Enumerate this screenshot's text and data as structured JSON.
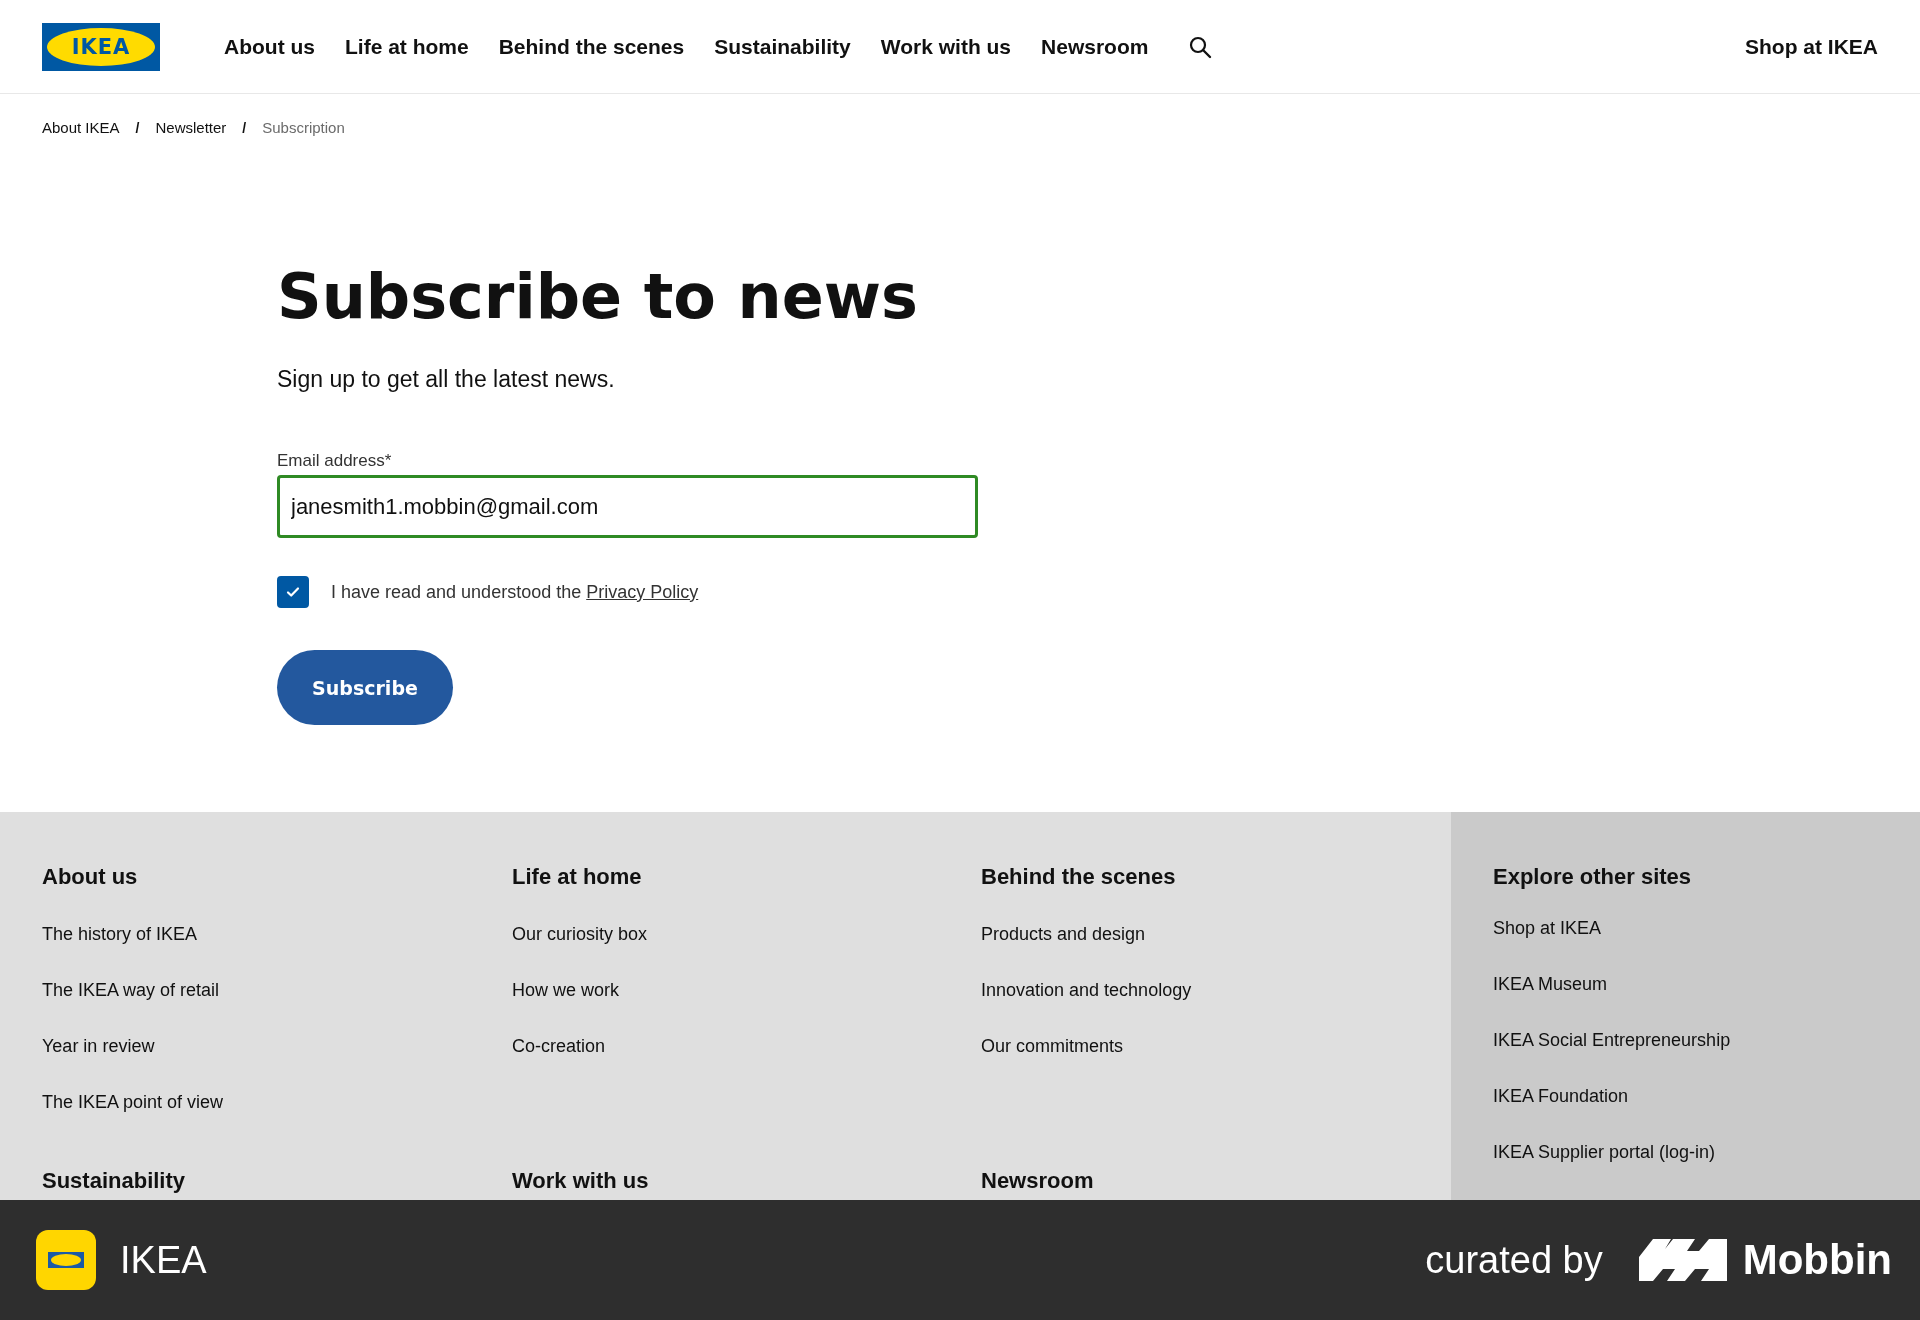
{
  "header": {
    "logo_text": "IKEA",
    "nav": [
      {
        "label": "About us"
      },
      {
        "label": "Life at home"
      },
      {
        "label": "Behind the scenes"
      },
      {
        "label": "Sustainability"
      },
      {
        "label": "Work with us"
      },
      {
        "label": "Newsroom"
      }
    ],
    "shop_link": "Shop at IKEA"
  },
  "breadcrumb": [
    {
      "label": "About IKEA",
      "current": false
    },
    {
      "label": "Newsletter",
      "current": false
    },
    {
      "label": "Subscription",
      "current": true
    }
  ],
  "breadcrumb_separator": "/",
  "form": {
    "title": "Subscribe to news",
    "subtitle": "Sign up to get all the latest news.",
    "email_label": "Email address*",
    "email_value": "janesmith1.mobbin@gmail.com",
    "consent_text": "I have read and understood the ",
    "consent_link": "Privacy Policy",
    "consent_checked": true,
    "submit": "Subscribe"
  },
  "footer": {
    "columns": [
      {
        "heading": "About us",
        "links": [
          "The history of IKEA",
          "The IKEA way of retail",
          "Year in review",
          "The IKEA point of view"
        ]
      },
      {
        "heading": "Life at home",
        "links": [
          "Our curiosity box",
          "How we work",
          "Co-creation"
        ]
      },
      {
        "heading": "Behind the scenes",
        "links": [
          "Products and design",
          "Innovation and technology",
          "Our commitments"
        ]
      },
      {
        "heading": "Sustainability"
      },
      {
        "heading": "Work with us"
      },
      {
        "heading": "Newsroom"
      }
    ],
    "other_sites": {
      "heading": "Explore other sites",
      "links": [
        "Shop at IKEA",
        "IKEA Museum",
        "IKEA Social Entrepreneurship",
        "IKEA Foundation",
        "IKEA Supplier portal (log-in)"
      ]
    }
  },
  "brand_bar": {
    "app_name": "IKEA",
    "curated_by": "curated by",
    "brand": "Mobbin"
  }
}
